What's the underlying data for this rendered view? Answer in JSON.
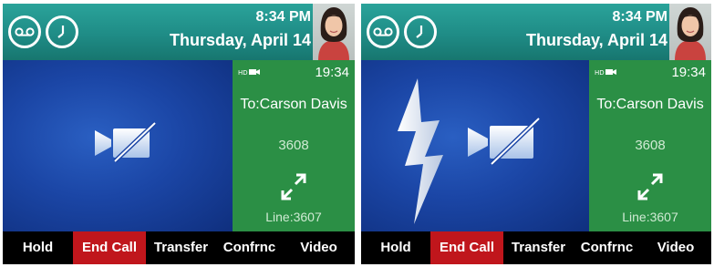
{
  "colors": {
    "topbar": "#1f8c86",
    "panel": "#2b8f45",
    "video": "#1b46a6",
    "end_call": "#c0161c",
    "softkey_bar": "#000000"
  },
  "screens": [
    {
      "header": {
        "time": "8:34 PM",
        "date": "Thursday, April 14",
        "icons": [
          "voicemail-icon",
          "history-clock-icon"
        ]
      },
      "call": {
        "duration": "19:34",
        "to": "To:Carson Davis",
        "number": "3608",
        "line": "Line:3607"
      },
      "softkeys": [
        {
          "label": "Hold"
        },
        {
          "label": "End Call"
        },
        {
          "label": "Transfer"
        },
        {
          "label": "Confrnc"
        },
        {
          "label": "Video"
        }
      ]
    },
    {
      "header": {
        "time": "8:34 PM",
        "date": "Thursday, April 14",
        "icons": [
          "voicemail-icon",
          "history-clock-icon"
        ]
      },
      "call": {
        "duration": "19:34",
        "to": "To:Carson Davis",
        "number": "3608",
        "line": "Line:3607"
      },
      "softkeys": [
        {
          "label": "Hold"
        },
        {
          "label": "End Call"
        },
        {
          "label": "Transfer"
        },
        {
          "label": "Confrnc"
        },
        {
          "label": "Video"
        }
      ]
    }
  ]
}
